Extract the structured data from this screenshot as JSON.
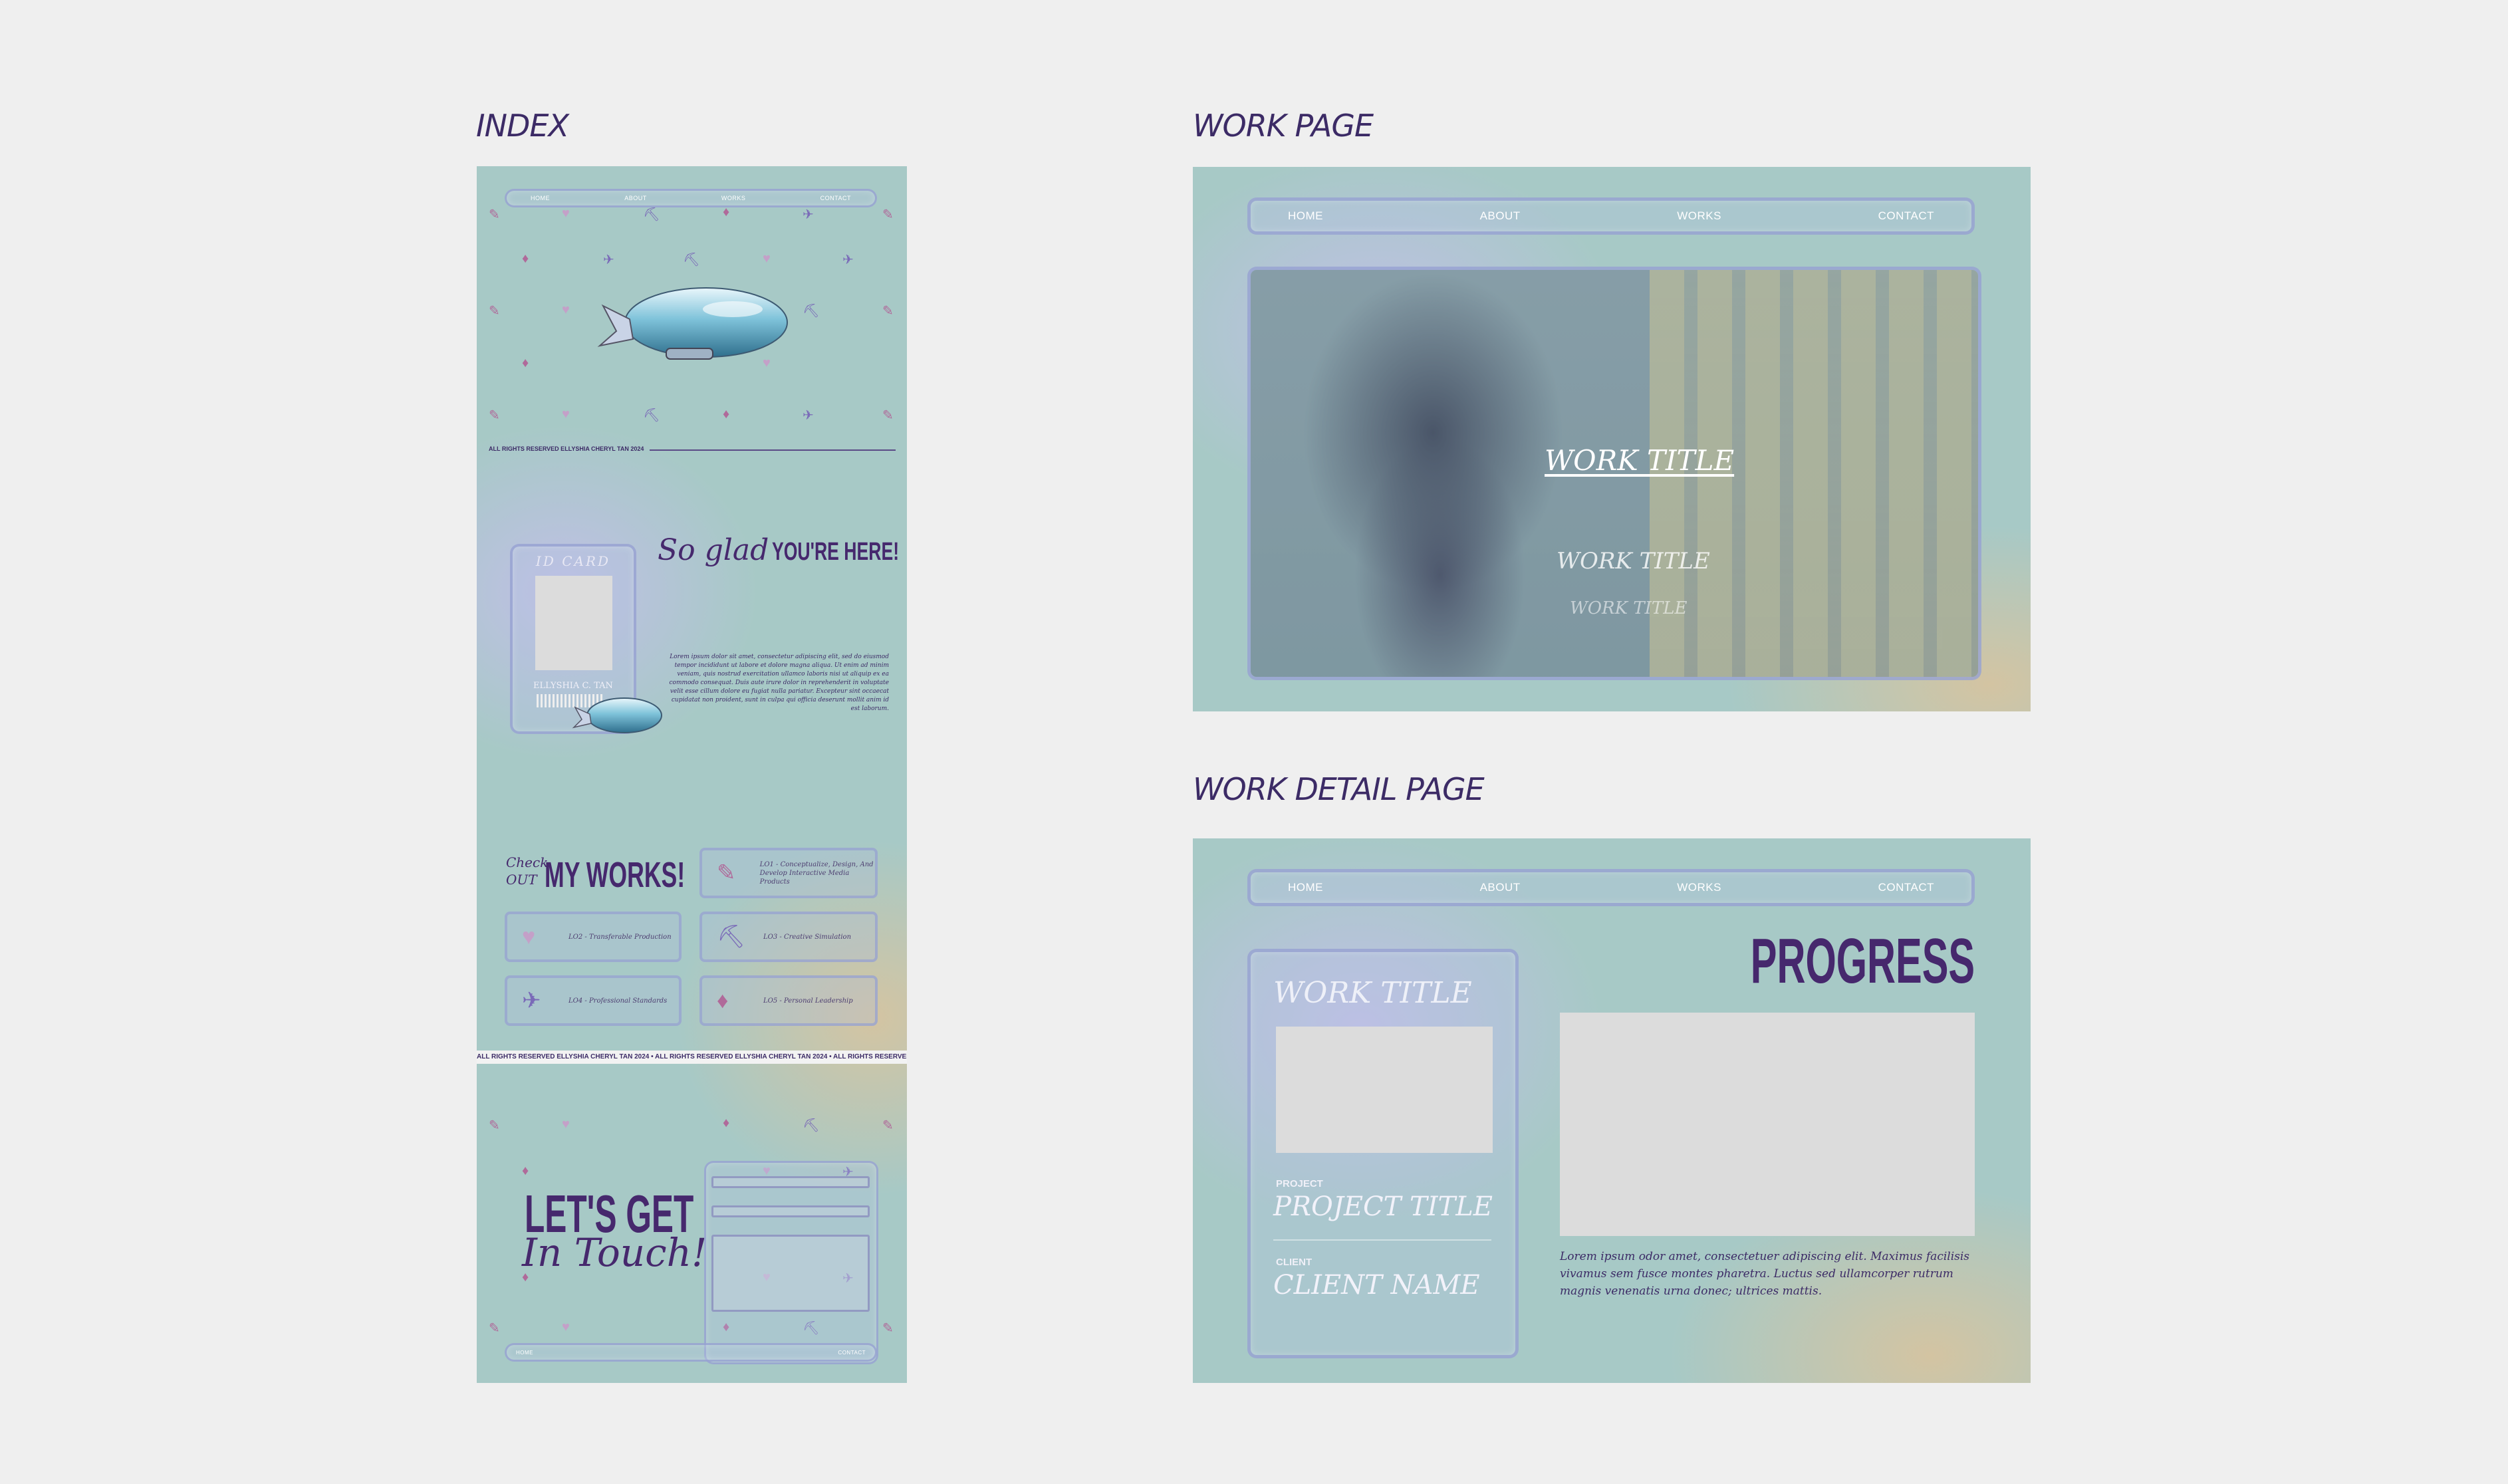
{
  "frames": {
    "index": "INDEX",
    "work": "WORK PAGE",
    "detail": "WORK DETAIL PAGE"
  },
  "nav": {
    "home": "HOME",
    "about": "ABOUT",
    "works": "WORKS",
    "contact": "CONTACT"
  },
  "index": {
    "rights": "ALL RIGHTS RESERVED ELLYSHIA CHERYL TAN 2024",
    "id_card": "ID CARD",
    "id_name": "ELLYSHIA C. TAN",
    "glad_prefix": "So glad",
    "glad_strong": "YOU'RE HERE!",
    "about_text": "Lorem ipsum dolor sit amet, consectetur adipiscing elit, sed do eiusmod tempor incididunt ut labore et dolore magna aliqua. Ut enim ad minim veniam, quis nostrud exercitation ullamco laboris nisi ut aliquip ex ea commodo consequat. Duis aute irure dolor in reprehenderit in voluptate velit esse cillum dolore eu fugiat nulla pariatur. Excepteur sint occaecat cupidatat non proident, sunt in culpa qui officia deserunt mollit anim id est laborum.",
    "check": "Check",
    "out": "OUT",
    "my_works": "MY WORKS!",
    "works": [
      {
        "icon": "lipstick-icon",
        "glyph": "✎",
        "label": "LO1 - Conceptualize, Design, And Develop Interactive Media Products"
      },
      {
        "icon": "heart-icon",
        "glyph": "♥",
        "label": "LO2 - Transferable Production"
      },
      {
        "icon": "pickaxe-icon",
        "glyph": "⛏",
        "label": "LO3 - Creative Simulation"
      },
      {
        "icon": "hairdryer-icon",
        "glyph": "✈",
        "label": "LO4 - Professional Standards"
      },
      {
        "icon": "strawberry-icon",
        "glyph": "♦",
        "label": "LO5 - Personal Leadership"
      }
    ],
    "ticker": "ALL RIGHTS RESERVED ELLYSHIA CHERYL TAN 2024  •  ALL RIGHTS RESERVED ELLYSHIA CHERYL TAN 2024  •  ALL RIGHTS RESERVED ELLYSHIA CHERYL TAN 2024",
    "lets_get": "LET'S GET",
    "in_touch": "In Touch!",
    "footer_left": "HOME",
    "footer_right": "CONTACT"
  },
  "work": {
    "title1": "WORK TITLE",
    "title2": "WORK TITLE",
    "title3": "WORK TITLE"
  },
  "detail": {
    "work_title": "WORK TITLE",
    "project_label": "PROJECT",
    "project_title": "PROJECT TITLE",
    "client_label": "CLIENT",
    "client_name": "CLIENT NAME",
    "progress": "PROGRESS",
    "body": "Lorem ipsum odor amet, consectetuer adipiscing elit. Maximus facilisis vivamus sem fusce montes pharetra. Luctus sed ullamcorper rutrum magnis venenatis urna donec; ultrices mattis."
  },
  "colors": {
    "background": "#efefef",
    "teal": "#a7c9c6",
    "lavender": "#c4beeb",
    "sand": "#d6c4a0",
    "purple_text": "#46286d"
  }
}
